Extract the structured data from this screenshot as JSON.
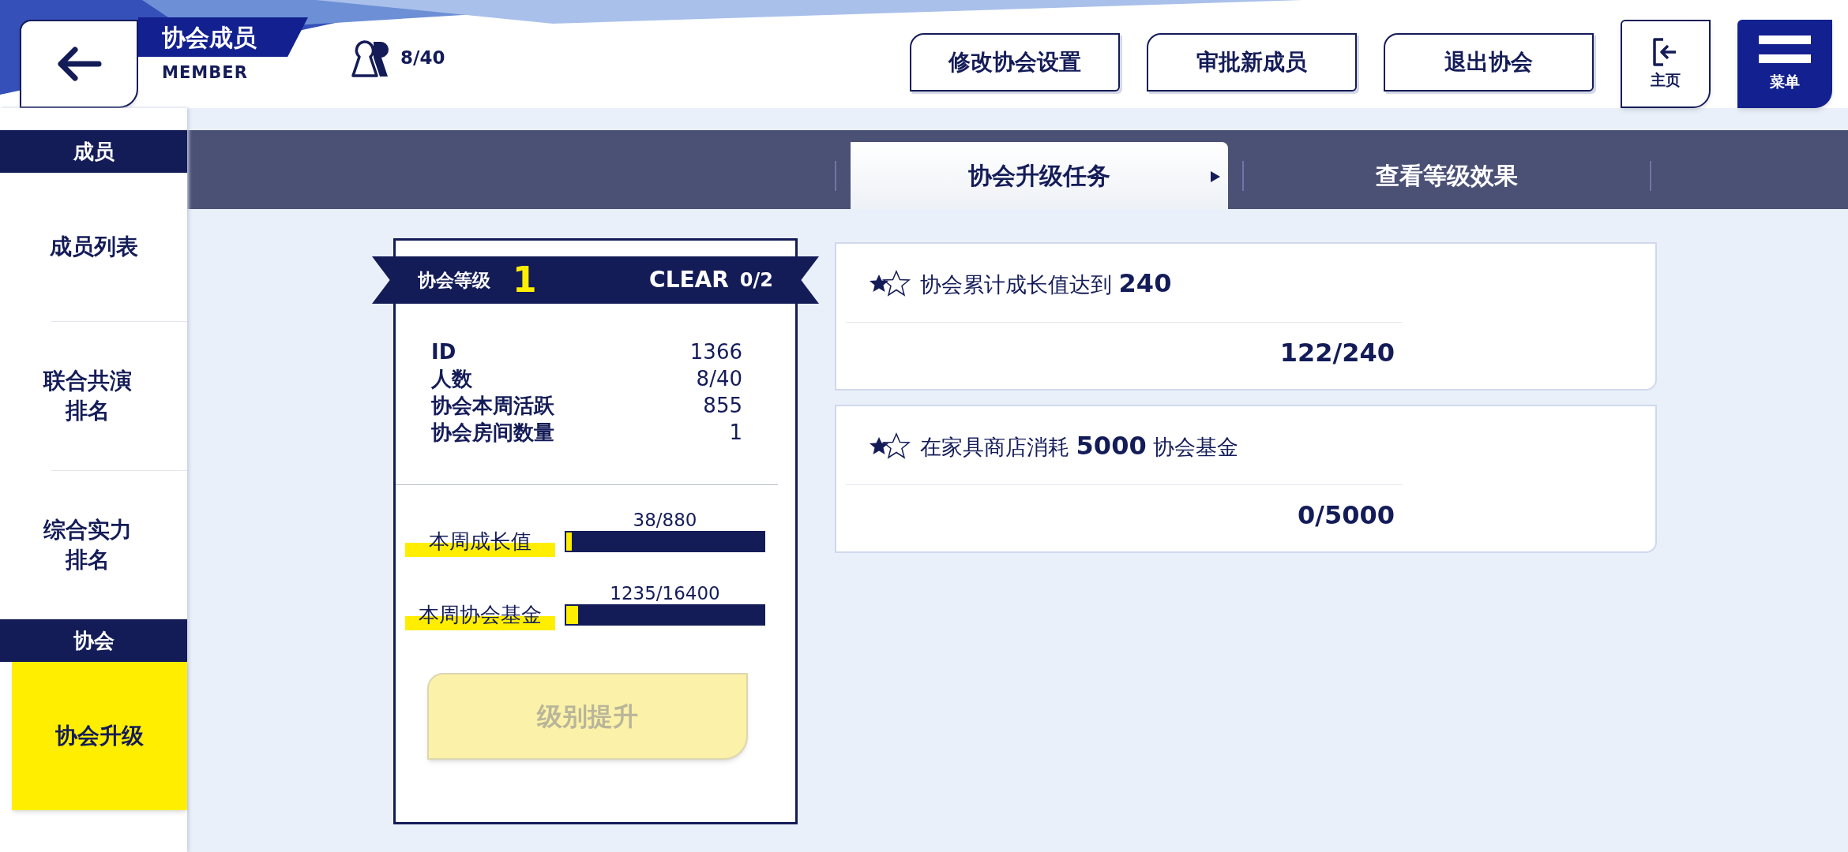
{
  "header": {
    "title": "协会成员",
    "subtitle": "MEMBER",
    "member_count": "8/40"
  },
  "actions": [
    {
      "label": "修改协会设置"
    },
    {
      "label": "审批新成员"
    },
    {
      "label": "退出协会"
    }
  ],
  "home_button": {
    "label": "主页"
  },
  "menu_button": {
    "label": "菜单"
  },
  "sidebar": {
    "sections": [
      {
        "title": "成员",
        "items": [
          {
            "label": "成员列表",
            "selected": false
          },
          {
            "label": "联合共演排名",
            "selected": false
          },
          {
            "label": "综合实力排名",
            "selected": false
          }
        ]
      },
      {
        "title": "协会",
        "items": [
          {
            "label": "协会升级",
            "selected": true
          }
        ]
      }
    ]
  },
  "tabs": [
    {
      "label": "协会升级任务",
      "selected": true
    },
    {
      "label": "查看等级效果",
      "selected": false
    }
  ],
  "level_card": {
    "label": "协会等级",
    "level_value": "1",
    "clear_label": "CLEAR",
    "clear_count": "0/2",
    "stats": [
      {
        "label": "ID",
        "value": "1366"
      },
      {
        "label": "人数",
        "value": "8/40"
      },
      {
        "label": "协会本周活跃",
        "value": "855"
      },
      {
        "label": "协会房间数量",
        "value": "1"
      }
    ],
    "meters": [
      {
        "label": "本周成长值",
        "reading": "38/880",
        "level": 0.043
      },
      {
        "label": "本周协会基金",
        "reading": "1235/16400",
        "level": 0.075
      }
    ],
    "upgrade_button": {
      "label": "级别提升",
      "disabled": true
    }
  },
  "tasks": [
    {
      "text": "协会累计成长值达到 **240**",
      "progress": "122/240"
    },
    {
      "text": "在家具商店消耗 **5000** 协会基金",
      "progress": "0/5000"
    }
  ]
}
